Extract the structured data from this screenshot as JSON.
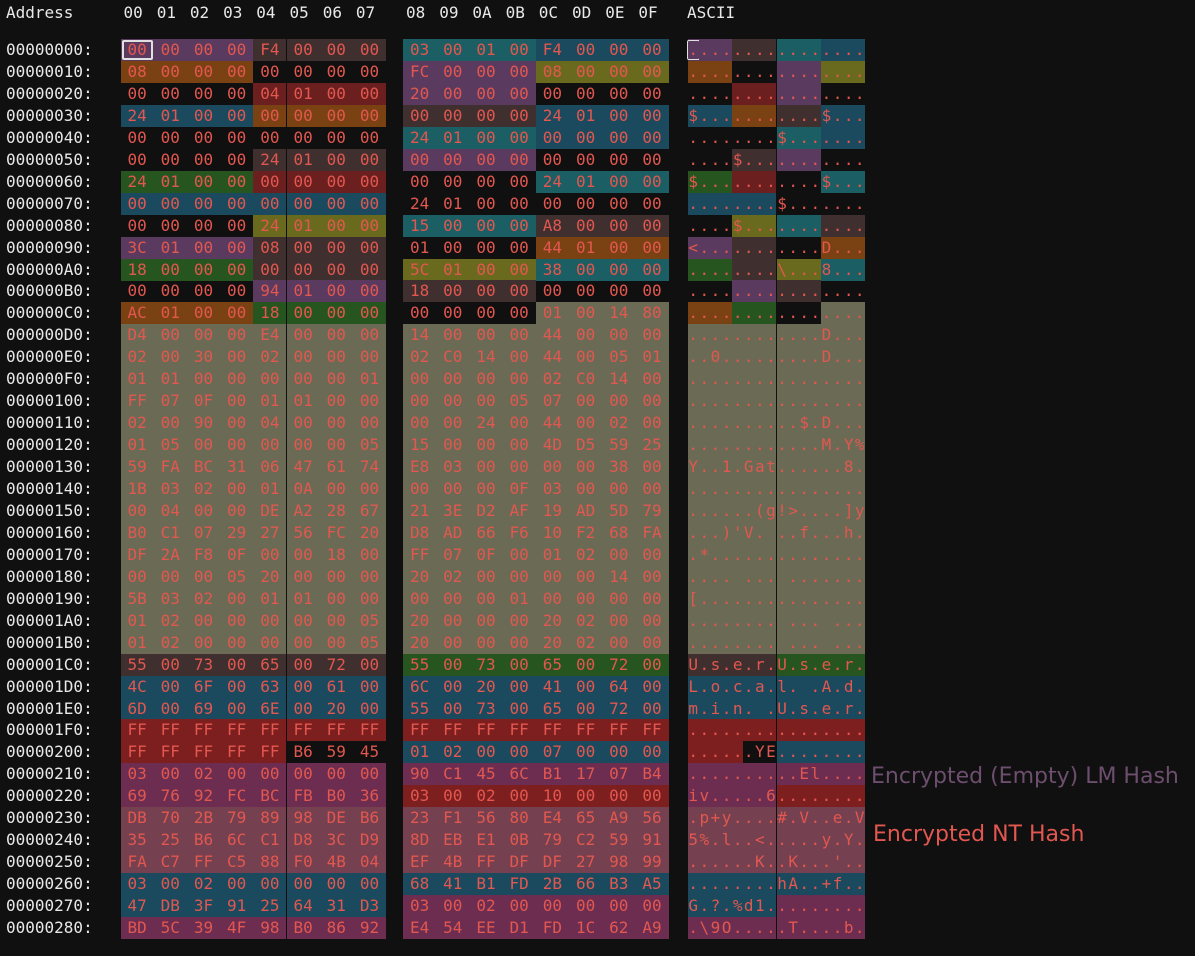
{
  "header": {
    "address_label": "Address",
    "columns_left": [
      "00",
      "01",
      "02",
      "03",
      "04",
      "05",
      "06",
      "07"
    ],
    "columns_right": [
      "08",
      "09",
      "0A",
      "0B",
      "0C",
      "0D",
      "0E",
      "0F"
    ],
    "ascii_label": "ASCII"
  },
  "colors": {
    "default_text": "#e8e8e8",
    "byte_text": "#e2574f",
    "background": "#101010",
    "cursor_border": "#e0e0e0",
    "lm_label": "#6d4e6e",
    "nt_label": "#e2574f"
  },
  "palette": {
    "A": "#5a3a5e",
    "B": "#3f2f2f",
    "C": "#1b4a5e",
    "D": "#7a4112",
    "E": "#1b5e63",
    "F": "#6a6a1e",
    "G": "#6b1f1f",
    "H": "#27551f",
    "I": "#6b6b55",
    "J": "#6d2d50",
    "K": "#7e1f1f",
    "L": "#75404f"
  },
  "rows": [
    {
      "addr": "00000000:",
      "hex": "00 00 00 00 F4 00 00 00 03 00 01 00 F4 00 00 00",
      "ascii": "................",
      "fill": "AAAABBBBEEEECCCC"
    },
    {
      "addr": "00000010:",
      "hex": "08 00 00 00 00 00 00 00 FC 00 00 00 08 00 00 00",
      "ascii": "................",
      "fill": "DDDD....AAAAFFFF"
    },
    {
      "addr": "00000020:",
      "hex": "00 00 00 00 04 01 00 00 20 00 00 00 00 00 00 00",
      "ascii": "................",
      "fill": "....GGGGAAAA...."
    },
    {
      "addr": "00000030:",
      "hex": "24 01 00 00 00 00 00 00 00 00 00 00 24 01 00 00",
      "ascii": "$...........$...",
      "fill": "CCCCDDDDBBBBCCCC"
    },
    {
      "addr": "00000040:",
      "hex": "00 00 00 00 00 00 00 00 24 01 00 00 00 00 00 00",
      "ascii": "........$.......",
      "fill": "........EEEECCCC"
    },
    {
      "addr": "00000050:",
      "hex": "00 00 00 00 24 01 00 00 00 00 00 00 00 00 00 00",
      "ascii": "....$...........",
      "fill": "....BBBBAAAA...."
    },
    {
      "addr": "00000060:",
      "hex": "24 01 00 00 00 00 00 00 00 00 00 00 24 01 00 00",
      "ascii": "$...........$...",
      "fill": "HHHHGGGG....EEEE"
    },
    {
      "addr": "00000070:",
      "hex": "00 00 00 00 00 00 00 00 24 01 00 00 00 00 00 00",
      "ascii": "........$.......",
      "fill": "CCCCCCCC........"
    },
    {
      "addr": "00000080:",
      "hex": "00 00 00 00 24 01 00 00 15 00 00 00 A8 00 00 00",
      "ascii": "....$...........",
      "fill": "....FFFFEEEEBBBB"
    },
    {
      "addr": "00000090:",
      "hex": "3C 01 00 00 08 00 00 00 01 00 00 00 44 01 00 00",
      "ascii": "<...........D...",
      "fill": "AAAABBBB....DDDD"
    },
    {
      "addr": "000000A0:",
      "hex": "18 00 00 00 00 00 00 00 5C 01 00 00 38 00 00 00",
      "ascii": "........\\...8...",
      "fill": "HHHHBBBBFFFFEEEE"
    },
    {
      "addr": "000000B0:",
      "hex": "00 00 00 00 94 01 00 00 18 00 00 00 00 00 00 00",
      "ascii": "................",
      "fill": "....AAAABBBB...."
    },
    {
      "addr": "000000C0:",
      "hex": "AC 01 00 00 18 00 00 00 00 00 00 00 01 00 14 80",
      "ascii": "................",
      "fill": "DDDDHHHH....IIII"
    },
    {
      "addr": "000000D0:",
      "hex": "D4 00 00 00 E4 00 00 00 14 00 00 00 44 00 00 00",
      "ascii": "............D...",
      "fill": "IIIIIIIIIIIIIIII"
    },
    {
      "addr": "000000E0:",
      "hex": "02 00 30 00 02 00 00 00 02 C0 14 00 44 00 05 01",
      "ascii": "..0.........D...",
      "fill": "IIIIIIIIIIIIIIII"
    },
    {
      "addr": "000000F0:",
      "hex": "01 01 00 00 00 00 00 01 00 00 00 00 02 C0 14 00",
      "ascii": "................",
      "fill": "IIIIIIIIIIIIIIII"
    },
    {
      "addr": "00000100:",
      "hex": "FF 07 0F 00 01 01 00 00 00 00 00 05 07 00 00 00",
      "ascii": "................",
      "fill": "IIIIIIIIIIIIIIII"
    },
    {
      "addr": "00000110:",
      "hex": "02 00 90 00 04 00 00 00 00 00 24 00 44 00 02 00",
      "ascii": "..........$.D...",
      "fill": "IIIIIIIIIIIIIIII"
    },
    {
      "addr": "00000120:",
      "hex": "01 05 00 00 00 00 00 05 15 00 00 00 4D D5 59 25",
      "ascii": "............M.Y%",
      "fill": "IIIIIIIIIIIIIIII"
    },
    {
      "addr": "00000130:",
      "hex": "59 FA BC 31 06 47 61 74 E8 03 00 00 00 00 38 00",
      "ascii": "Y..1.Gat......8.",
      "fill": "IIIIIIIIIIIIIIII"
    },
    {
      "addr": "00000140:",
      "hex": "1B 03 02 00 01 0A 00 00 00 00 00 0F 03 00 00 00",
      "ascii": "................",
      "fill": "IIIIIIIIIIIIIIII"
    },
    {
      "addr": "00000150:",
      "hex": "00 04 00 00 DE A2 28 67 21 3E D2 AF 19 AD 5D 79",
      "ascii": "......(g!>....]y",
      "fill": "IIIIIIIIIIIIIIII"
    },
    {
      "addr": "00000160:",
      "hex": "B0 C1 07 29 27 56 FC 20 D8 AD 66 F6 10 F2 68 FA",
      "ascii": "...)'V. ..f...h.",
      "fill": "IIIIIIIIIIIIIIII"
    },
    {
      "addr": "00000170:",
      "hex": "DF 2A F8 0F 00 00 18 00 FF 07 0F 00 01 02 00 00",
      "ascii": ".*..............",
      "fill": "IIIIIIIIIIIIIIII"
    },
    {
      "addr": "00000180:",
      "hex": "00 00 00 05 20 00 00 00 20 02 00 00 00 00 14 00",
      "ascii": ".... ... .......",
      "fill": "IIIIIIIIIIIIIIII"
    },
    {
      "addr": "00000190:",
      "hex": "5B 03 02 00 01 01 00 00 00 00 00 01 00 00 00 00",
      "ascii": "[...............",
      "fill": "IIIIIIIIIIIIIIII"
    },
    {
      "addr": "000001A0:",
      "hex": "01 02 00 00 00 00 00 05 20 00 00 00 20 02 00 00",
      "ascii": "........ ... ...",
      "fill": "IIIIIIIIIIIIIIII"
    },
    {
      "addr": "000001B0:",
      "hex": "01 02 00 00 00 00 00 05 20 00 00 00 20 02 00 00",
      "ascii": "........ ... ...",
      "fill": "IIIIIIIIIIIIIIII"
    },
    {
      "addr": "000001C0:",
      "hex": "55 00 73 00 65 00 72 00 55 00 73 00 65 00 72 00",
      "ascii": "U.s.e.r.U.s.e.r.",
      "fill": "BBBBBBBBHHHHHHHH"
    },
    {
      "addr": "000001D0:",
      "hex": "4C 00 6F 00 63 00 61 00 6C 00 20 00 41 00 64 00",
      "ascii": "L.o.c.a.l. .A.d.",
      "fill": "CCCCCCCCCCCCCCCC"
    },
    {
      "addr": "000001E0:",
      "hex": "6D 00 69 00 6E 00 20 00 55 00 73 00 65 00 72 00",
      "ascii": "m.i.n. .U.s.e.r.",
      "fill": "CCCCCCCCCCCCCCCC"
    },
    {
      "addr": "000001F0:",
      "hex": "FF FF FF FF FF FF FF FF FF FF FF FF FF FF FF FF",
      "ascii": "................",
      "fill": "KKKKKKKKKKKKKKKK"
    },
    {
      "addr": "00000200:",
      "hex": "FF FF FF FF FF B6 59 45 01 02 00 00 07 00 00 00",
      "ascii": "......YE........",
      "fill": "KKKKK...CCCCCCCC"
    },
    {
      "addr": "00000210:",
      "hex": "03 00 02 00 00 00 00 00 90 C1 45 6C B1 17 07 B4",
      "ascii": "..........El....",
      "fill": "JJJJJJJJJJJJJJJJ"
    },
    {
      "addr": "00000220:",
      "hex": "69 76 92 FC BC FB B0 36 03 00 02 00 10 00 00 00",
      "ascii": "iv.....6........",
      "fill": "JJJJJJJJKKKKKKKK"
    },
    {
      "addr": "00000230:",
      "hex": "DB 70 2B 79 89 98 DE B6 23 F1 56 80 E4 65 A9 56",
      "ascii": ".p+y....#.V..e.V",
      "fill": "LLLLLLLLLLLLLLLL"
    },
    {
      "addr": "00000240:",
      "hex": "35 25 B6 6C C1 D8 3C D9 8D EB E1 0B 79 C2 59 91",
      "ascii": "5%.l..<.....y.Y.",
      "fill": "LLLLLLLLLLLLLLLL"
    },
    {
      "addr": "00000250:",
      "hex": "FA C7 FF C5 88 F0 4B 04 EF 4B FF DF DF 27 98 99",
      "ascii": "......K..K...'..",
      "fill": "LLLLLLLLLLLLLLLL"
    },
    {
      "addr": "00000260:",
      "hex": "03 00 02 00 00 00 00 00 68 41 B1 FD 2B 66 B3 A5",
      "ascii": "........hA..+f..",
      "fill": "CCCCCCCCCCCCCCCC"
    },
    {
      "addr": "00000270:",
      "hex": "47 DB 3F 91 25 64 31 D3 03 00 02 00 00 00 00 00",
      "ascii": "G.?.%d1.........",
      "fill": "CCCCCCCCJJJJJJJJ"
    },
    {
      "addr": "00000280:",
      "hex": "BD 5C 39 4F 98 B0 86 92 E4 54 EE D1 FD 1C 62 A9",
      "ascii": ".\\9O.....T....b.",
      "fill": "JJJJJJJJJJJJJJJJ"
    }
  ],
  "selected": {
    "row": 0,
    "col": 0
  },
  "annotations": {
    "lm_hash": "Encrypted (Empty) LM Hash",
    "nt_hash": "Encrypted NT Hash"
  }
}
